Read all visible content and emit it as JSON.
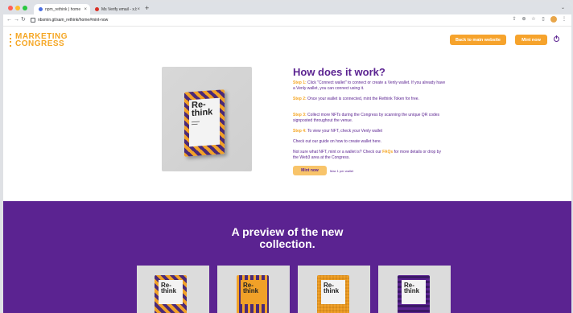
{
  "browser": {
    "tabs": [
      {
        "title": "npm_rethink | home",
        "close": "×",
        "icon_color": "#4a6ee0",
        "active": true
      },
      {
        "title": "Ms Verify email - x.bunzu@NNtrr",
        "close": "×",
        "icon_color": "#d93025",
        "active": false
      }
    ],
    "new_tab": "+",
    "url": "nbsmin.gt/sam_rethink/home#mint-now",
    "window_dots": [
      "#ff5f57",
      "#febc2e",
      "#28c840"
    ]
  },
  "header": {
    "logo_line1": "MARKETING",
    "logo_line2": "CONGRESS",
    "back_button": "Back to main website",
    "mint_button": "Mint now",
    "accent": "#f6a32c",
    "brand_purple": "#5b2391"
  },
  "how": {
    "title": "How does it work?",
    "step1_label": "Step 1:",
    "step1_text": " Click \"Connect wallet\" to connect or create a Venly wallet. If you already have a Venly wallet, you can connect using it.",
    "step2_label": "Step 2:",
    "step2_text": " Once your wallet is connected, mint the Rethink Token for free.",
    "step3_label": "Step 3:",
    "step3_text": " Collect more NFTs during the Congress by scanning the unique QR codes signposted throughout the venue.",
    "step4_label": "Step 4:",
    "step4_text": " To view your NFT, check your Venly wallet",
    "guide_text": "Check out our guide on how to create wallet here.",
    "faq_pre": "Not sure what NFT, mint or a wallet is? Check our ",
    "faq_link": "FAQs",
    "faq_post": " for more details or drop by the Web3 area at the Congress.",
    "mint_button": "Mint now",
    "max_note": "Max 1 per wallet"
  },
  "book": {
    "word_line1": "Re-",
    "word_line2": "think"
  },
  "preview": {
    "title_line1": "A preview of the new",
    "title_line2": "collection."
  }
}
